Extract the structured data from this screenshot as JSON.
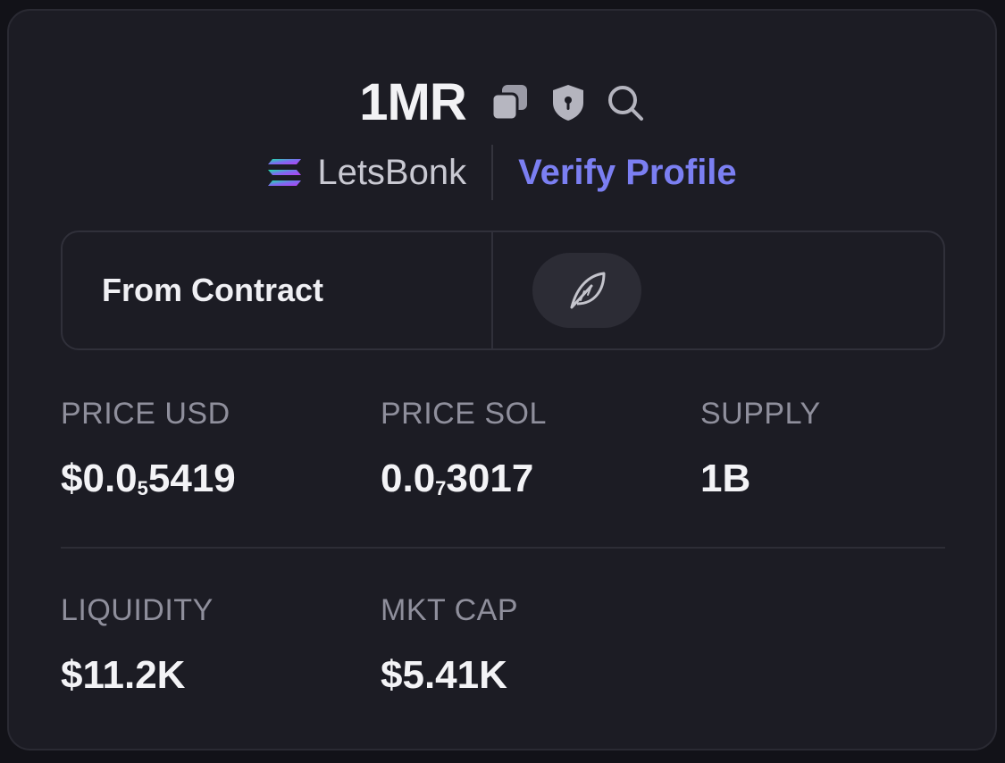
{
  "token": {
    "symbol": "1MR",
    "platform": "LetsBonk",
    "verify_label": "Verify Profile"
  },
  "icons": {
    "copy": "copy-icon",
    "shield": "shield-icon",
    "search": "search-icon",
    "platform_logo": "solana-logo-icon",
    "leaf": "leaf-icon"
  },
  "source": {
    "label": "From Contract"
  },
  "stats_row1": [
    {
      "label": "PRICE USD",
      "prefix": "$0.0",
      "sub": "5",
      "suffix": "5419"
    },
    {
      "label": "PRICE SOL",
      "prefix": "0.0",
      "sub": "7",
      "suffix": "3017"
    },
    {
      "label": "SUPPLY",
      "prefix": "1B",
      "sub": "",
      "suffix": ""
    }
  ],
  "stats_row2": [
    {
      "label": "LIQUIDITY",
      "value": "$11.2K"
    },
    {
      "label": "MKT CAP",
      "value": "$5.41K"
    }
  ],
  "colors": {
    "background": "#1c1c24",
    "accent": "#7b7ff2",
    "text_primary": "#f2f2f5",
    "text_muted": "#8f8f9c"
  }
}
